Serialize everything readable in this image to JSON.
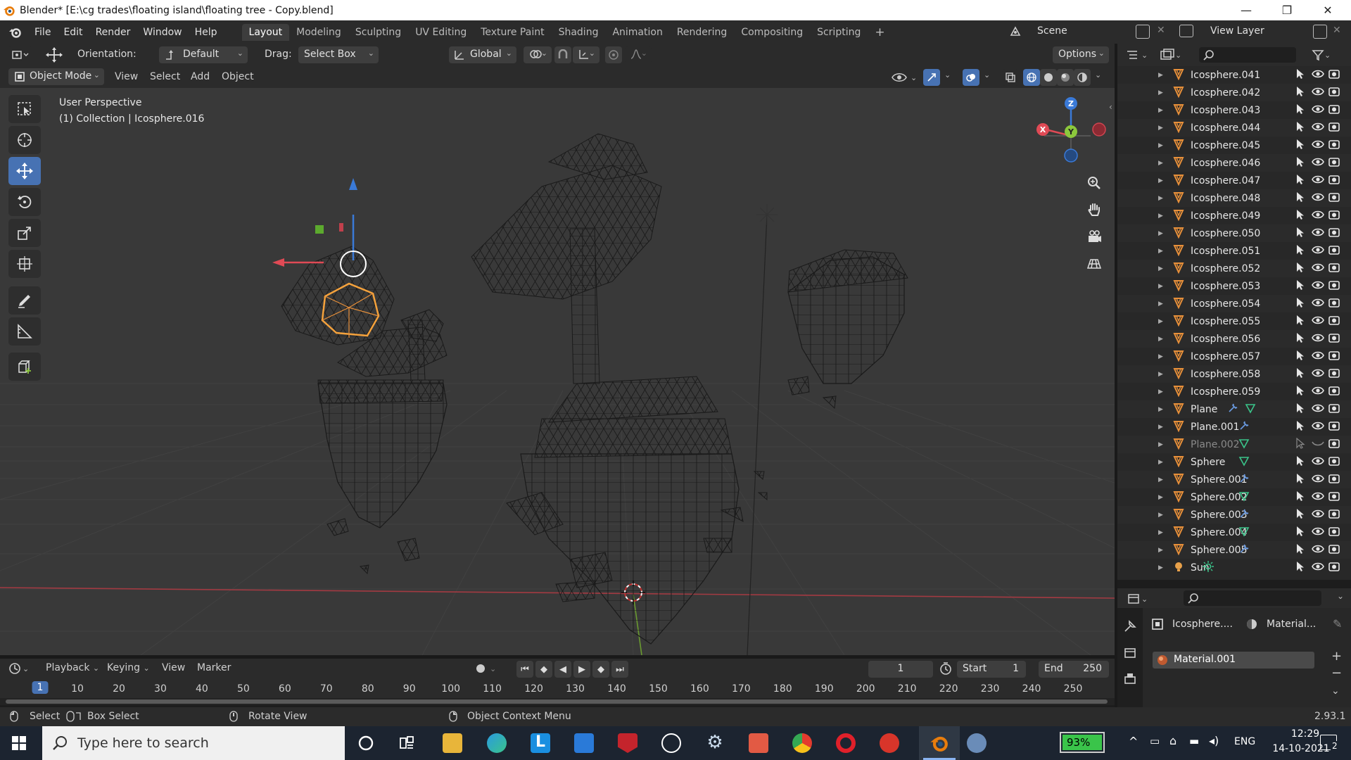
{
  "window": {
    "title": "Blender* [E:\\cg trades\\floating island\\floating tree - Copy.blend]",
    "minimize": "—",
    "maximize": "❐",
    "close": "✕"
  },
  "menu": [
    "File",
    "Edit",
    "Render",
    "Window",
    "Help"
  ],
  "workspaces": [
    "Layout",
    "Modeling",
    "Sculpting",
    "UV Editing",
    "Texture Paint",
    "Shading",
    "Animation",
    "Rendering",
    "Compositing",
    "Scripting"
  ],
  "workspace_add": "+",
  "scene": {
    "label": "Scene",
    "view_layer": "View Layer"
  },
  "tool_header": {
    "orientation_label": "Orientation:",
    "orientation_value": "Default",
    "drag_label": "Drag:",
    "drag_value": "Select Box",
    "transform_value": "Global",
    "options": "Options"
  },
  "viewport_header": {
    "mode": "Object Mode",
    "menus": [
      "View",
      "Select",
      "Add",
      "Object"
    ]
  },
  "viewport": {
    "perspective": "User Perspective",
    "collection": "(1) Collection | Icosphere.016",
    "gizmo": {
      "z": "Z",
      "y": "Y",
      "x": "X"
    }
  },
  "outliner": {
    "items": [
      {
        "name": "Icosphere.041",
        "extra": ""
      },
      {
        "name": "Icosphere.042",
        "extra": ""
      },
      {
        "name": "Icosphere.043",
        "extra": ""
      },
      {
        "name": "Icosphere.044",
        "extra": ""
      },
      {
        "name": "Icosphere.045",
        "extra": ""
      },
      {
        "name": "Icosphere.046",
        "extra": ""
      },
      {
        "name": "Icosphere.047",
        "extra": ""
      },
      {
        "name": "Icosphere.048",
        "extra": ""
      },
      {
        "name": "Icosphere.049",
        "extra": ""
      },
      {
        "name": "Icosphere.050",
        "extra": ""
      },
      {
        "name": "Icosphere.051",
        "extra": ""
      },
      {
        "name": "Icosphere.052",
        "extra": ""
      },
      {
        "name": "Icosphere.053",
        "extra": ""
      },
      {
        "name": "Icosphere.054",
        "extra": ""
      },
      {
        "name": "Icosphere.055",
        "extra": ""
      },
      {
        "name": "Icosphere.056",
        "extra": ""
      },
      {
        "name": "Icosphere.057",
        "extra": ""
      },
      {
        "name": "Icosphere.058",
        "extra": ""
      },
      {
        "name": "Icosphere.059",
        "extra": ""
      },
      {
        "name": "Plane",
        "extra": "wrench+mesh"
      },
      {
        "name": "Plane.001",
        "extra": "wrench"
      },
      {
        "name": "Plane.002",
        "extra": "mesh",
        "dim": true
      },
      {
        "name": "Sphere",
        "extra": "mesh"
      },
      {
        "name": "Sphere.001",
        "extra": "wrench"
      },
      {
        "name": "Sphere.002",
        "extra": "mesh"
      },
      {
        "name": "Sphere.003",
        "extra": "wrench"
      },
      {
        "name": "Sphere.004",
        "extra": "mesh"
      },
      {
        "name": "Sphere.005",
        "extra": "wrench"
      },
      {
        "name": "Sun",
        "extra": "sun",
        "light": true
      }
    ]
  },
  "properties": {
    "object": "Icosphere....",
    "material_tab": "Material...",
    "material_slot": "Material.001",
    "add": "+",
    "remove": "−",
    "down": "⌄"
  },
  "timeline": {
    "menus": [
      "Playback",
      "Keying",
      "View",
      "Marker"
    ],
    "current_frame": "1",
    "start_label": "Start",
    "start": "1",
    "end_label": "End",
    "end": "250",
    "ticks": [
      "1",
      "10",
      "20",
      "30",
      "40",
      "50",
      "60",
      "70",
      "80",
      "90",
      "100",
      "110",
      "120",
      "130",
      "140",
      "150",
      "160",
      "170",
      "180",
      "190",
      "200",
      "210",
      "220",
      "230",
      "240",
      "250"
    ]
  },
  "statusbar": {
    "select": "Select",
    "box_select": "Box Select",
    "rotate_view": "Rotate View",
    "context_menu": "Object Context Menu",
    "version": "2.93.1"
  },
  "taskbar": {
    "search_placeholder": "Type here to search",
    "battery": "93%",
    "language": "ENG",
    "time": "12:29",
    "date": "14-10-2021",
    "notifications": "2"
  },
  "colors": {
    "accent": "#4772b3",
    "object_orange": "#e8903a",
    "selected_orange": "#f5a23c",
    "axis_x": "#e04a55",
    "axis_y": "#8cc83c",
    "axis_z": "#3a7ad8"
  }
}
